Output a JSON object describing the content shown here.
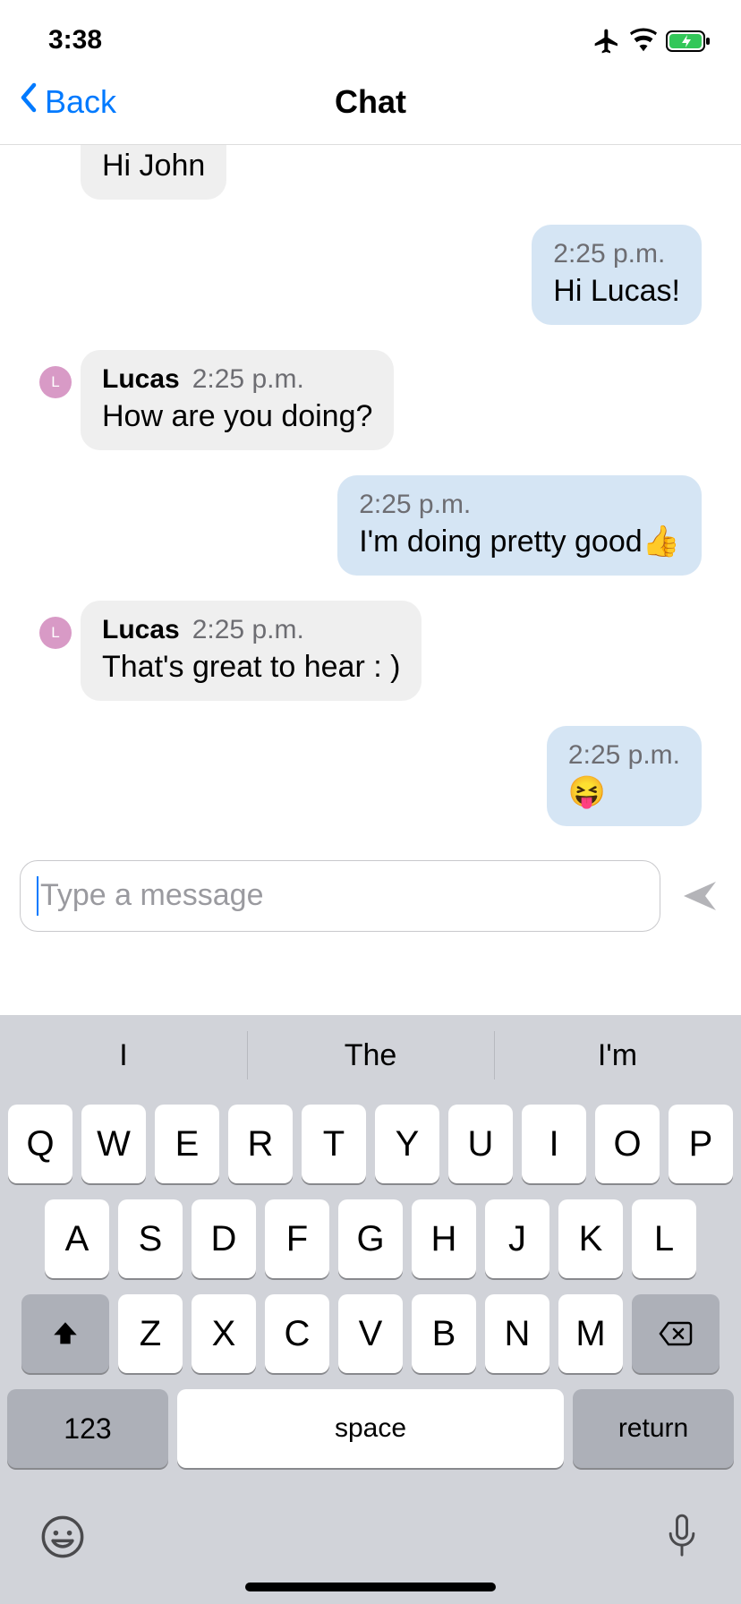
{
  "status": {
    "time": "3:38"
  },
  "nav": {
    "back": "Back",
    "title": "Chat"
  },
  "sender": "Lucas",
  "avatar_initial": "L",
  "messages": {
    "m0": {
      "text": "Hi John"
    },
    "m1": {
      "time": "2:25 p.m.",
      "text": "Hi Lucas!"
    },
    "m2": {
      "time": "2:25 p.m.",
      "text": "How are you doing?"
    },
    "m3": {
      "time": "2:25 p.m.",
      "text": "I'm doing pretty good👍"
    },
    "m4": {
      "time": "2:25 p.m.",
      "text": "That's great to hear : )"
    },
    "m5": {
      "time": "2:25 p.m.",
      "text": "😝"
    }
  },
  "input": {
    "placeholder": "Type a message"
  },
  "keyboard": {
    "suggestions": [
      "I",
      "The",
      "I'm"
    ],
    "row1": [
      "Q",
      "W",
      "E",
      "R",
      "T",
      "Y",
      "U",
      "I",
      "O",
      "P"
    ],
    "row2": [
      "A",
      "S",
      "D",
      "F",
      "G",
      "H",
      "J",
      "K",
      "L"
    ],
    "row3": [
      "Z",
      "X",
      "C",
      "V",
      "B",
      "N",
      "M"
    ],
    "numKey": "123",
    "space": "space",
    "returnKey": "return"
  }
}
